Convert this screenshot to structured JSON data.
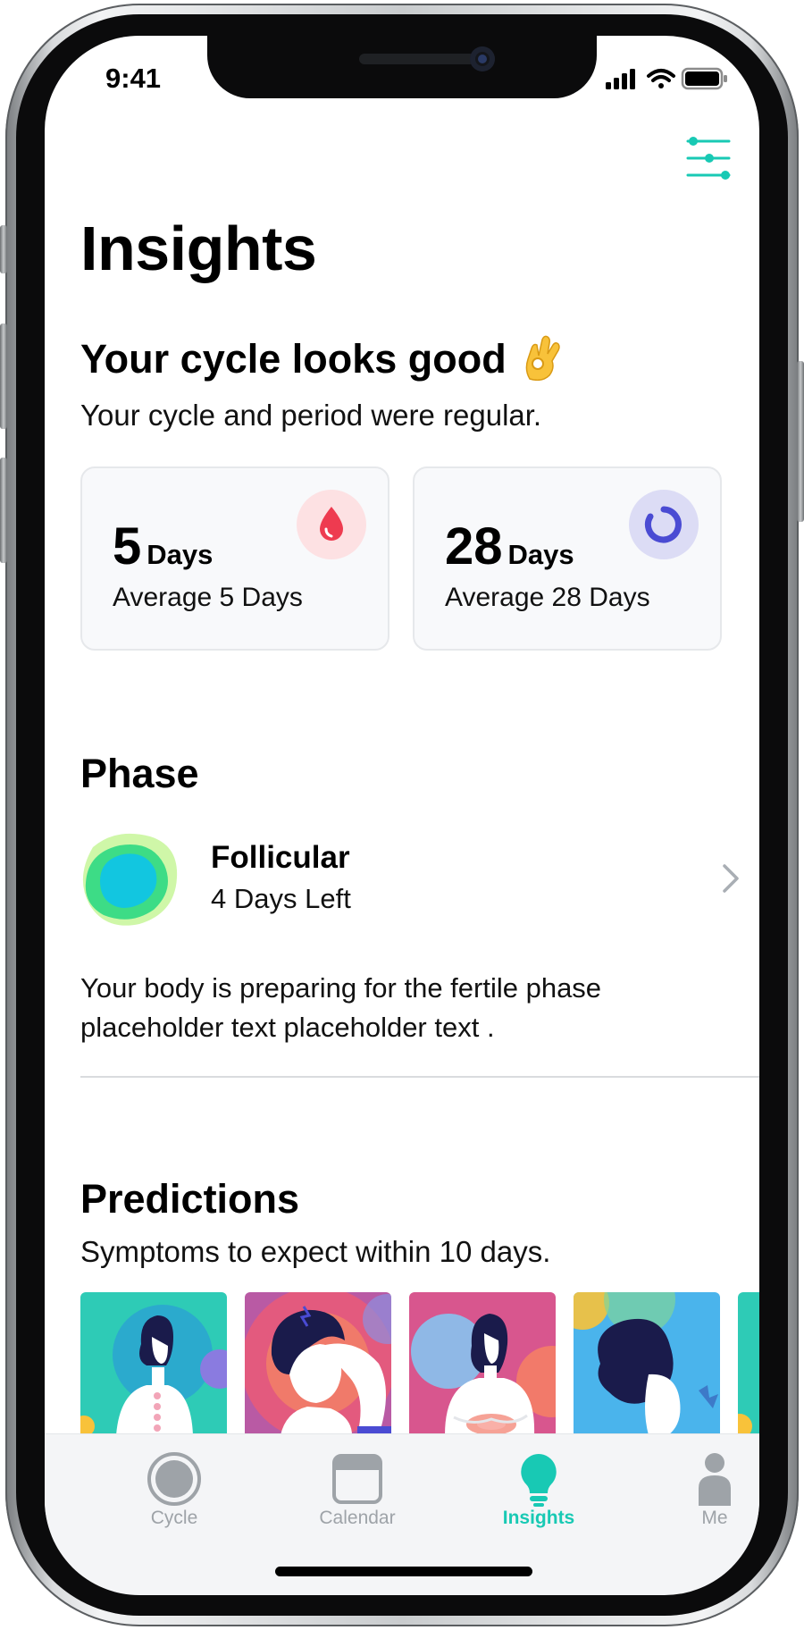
{
  "status_bar": {
    "time": "9:41"
  },
  "page": {
    "title": "Insights"
  },
  "summary": {
    "heading": "Your cycle looks good",
    "emoji": "👌",
    "subtitle": "Your cycle and period were regular."
  },
  "stats": [
    {
      "value": "5",
      "unit": "Days",
      "average": "Average 5 Days",
      "icon": "blood-drop-icon",
      "icon_bg": "#fde1e3",
      "icon_color": "#ee3b50"
    },
    {
      "value": "28",
      "unit": "Days",
      "average": "Average 28 Days",
      "icon": "cycle-ring-icon",
      "icon_bg": "#dcdcf5",
      "icon_color": "#4a4bd3"
    }
  ],
  "phase": {
    "heading": "Phase",
    "name": "Follicular",
    "days_left": "4 Days Left",
    "description": "Your body is preparing for the fertile phase placeholder text placeholder text ."
  },
  "predictions": {
    "heading": "Predictions",
    "subtitle": "Symptoms to expect within 10 days.",
    "cards": [
      "back-pain-illustration",
      "headache-illustration",
      "cramps-illustration",
      "hair-illustration",
      "partial-card"
    ]
  },
  "tabbar": {
    "tabs": [
      {
        "label": "Cycle",
        "icon": "cycle-circle-icon",
        "active": false
      },
      {
        "label": "Calendar",
        "icon": "calendar-icon",
        "active": false
      },
      {
        "label": "Insights",
        "icon": "lightbulb-icon",
        "active": true
      },
      {
        "label": "Me",
        "icon": "person-icon",
        "active": false
      }
    ]
  },
  "colors": {
    "accent": "#18c9b4",
    "tab_inactive": "#9ea3a8",
    "card_border": "#e6e8eb"
  }
}
